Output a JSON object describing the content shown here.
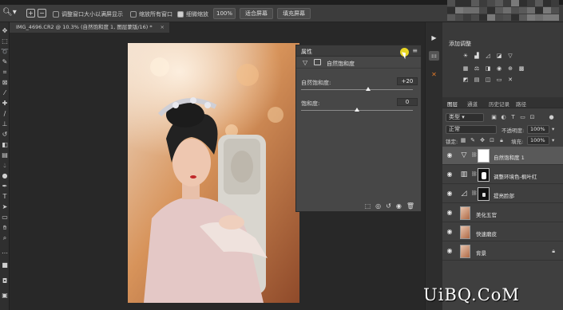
{
  "optionsbar": {
    "opt1_label": "调整窗口大小以满屏显示",
    "opt2_label": "缩放所有窗口",
    "opt3_label": "细微缩放",
    "zoom_value": "100%",
    "fit_label": "适合屏幕",
    "fill_label": "填充屏幕"
  },
  "document": {
    "tab_title": "IMG_4696.CR2 @ 10.3% (自然饱和度 1, 图层蒙版/16) *",
    "close_glyph": "×"
  },
  "properties": {
    "title": "属性",
    "adjustment_name": "自然饱和度",
    "vibrance_label": "自然饱和度:",
    "vibrance_value": "+20",
    "vibrance_fraction": 0.6,
    "saturation_label": "饱和度:",
    "saturation_value": "0",
    "saturation_fraction": 0.5
  },
  "adjustments": {
    "title": "添加调整"
  },
  "layers": {
    "tabs": [
      "图层",
      "通道",
      "历史记录",
      "路径"
    ],
    "kind_label": "类型",
    "blend_mode": "正常",
    "opacity_label": "不透明度:",
    "opacity_value": "100%",
    "lock_label": "锁定:",
    "fill_label": "填充:",
    "fill_value": "100%",
    "items": [
      {
        "name": "自然饱和度 1"
      },
      {
        "name": "调整环境色-枫叶红"
      },
      {
        "name": "提亮脸部"
      },
      {
        "name": "美化五官"
      },
      {
        "name": "快速磨皮"
      },
      {
        "name": "背景"
      }
    ]
  },
  "watermark": "UiBQ.CoM"
}
